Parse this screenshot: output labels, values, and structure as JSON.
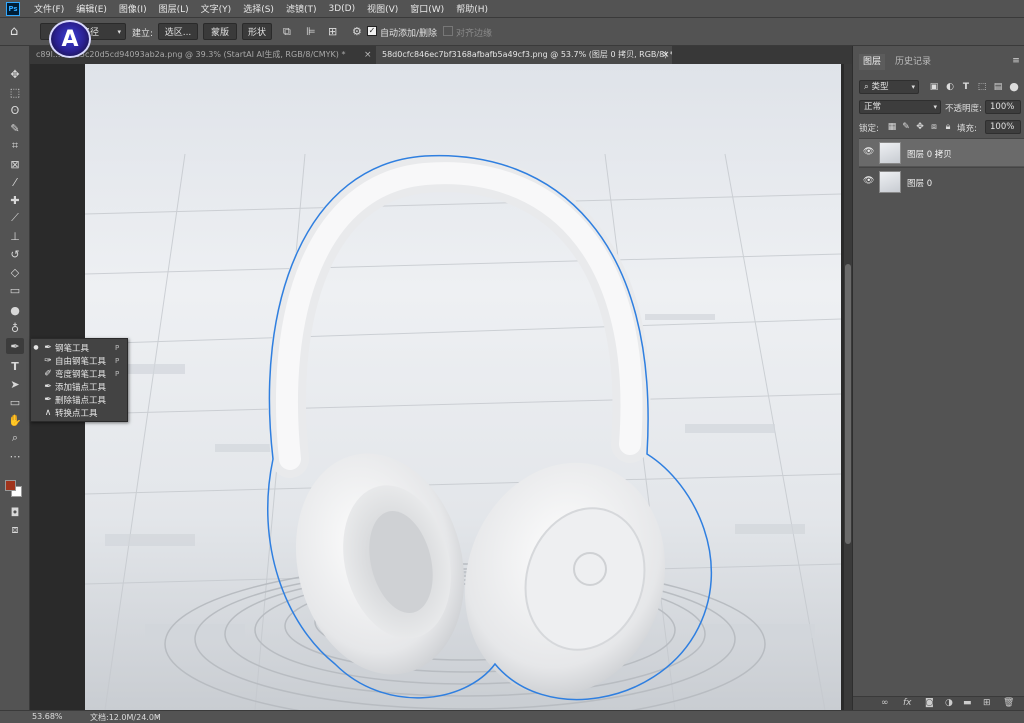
{
  "menubar": {
    "items": [
      "文件(F)",
      "编辑(E)",
      "图像(I)",
      "图层(L)",
      "文字(Y)",
      "选择(S)",
      "滤镜(T)",
      "3D(D)",
      "视图(V)",
      "窗口(W)",
      "帮助(H)"
    ]
  },
  "options": {
    "path_mode": "路径",
    "make_label": "建立:",
    "selection_btn": "选区...",
    "mask_btn": "蒙版",
    "shape_btn": "形状",
    "auto_add_delete": "自动添加/删除",
    "align_edges": "对齐边缘"
  },
  "tabs": [
    {
      "title": "c89l...e74c5c20d5cd94093ab2a.png @ 39.3% (StartAI AI生成, RGB/8/CMYK) *",
      "close": "×"
    },
    {
      "title": "58d0cfc846ec7bf3168afbafb5a49cf3.png @ 53.7% (图层 0 拷贝, RGB/8) *",
      "close": "×"
    }
  ],
  "flyout": {
    "items": [
      {
        "label": "钢笔工具",
        "key": "P",
        "icon": "pen-icon"
      },
      {
        "label": "自由钢笔工具",
        "key": "P",
        "icon": "freeform-pen-icon"
      },
      {
        "label": "弯度钢笔工具",
        "key": "P",
        "icon": "curvature-pen-icon"
      },
      {
        "label": "添加锚点工具",
        "key": "",
        "icon": "add-anchor-icon"
      },
      {
        "label": "删除锚点工具",
        "key": "",
        "icon": "delete-anchor-icon"
      },
      {
        "label": "转换点工具",
        "key": "",
        "icon": "convert-point-icon"
      }
    ]
  },
  "status": {
    "zoom": "53.68%",
    "doc_info": "文档:12.0M/24.0M"
  },
  "panel": {
    "tab_layers": "图层",
    "tab_history": "历史记录",
    "filter_kind": "类型",
    "blend_mode": "正常",
    "opacity_label": "不透明度:",
    "opacity_value": "100%",
    "lock_label": "锁定:",
    "fill_label": "填充:",
    "fill_value": "100%",
    "layers": [
      {
        "name": "图层 0 拷贝",
        "selected": true
      },
      {
        "name": "图层 0",
        "selected": false
      }
    ]
  },
  "colors": {
    "foreground": "#a0341c",
    "background": "#ffffff",
    "path_stroke": "#2f7fe0"
  }
}
